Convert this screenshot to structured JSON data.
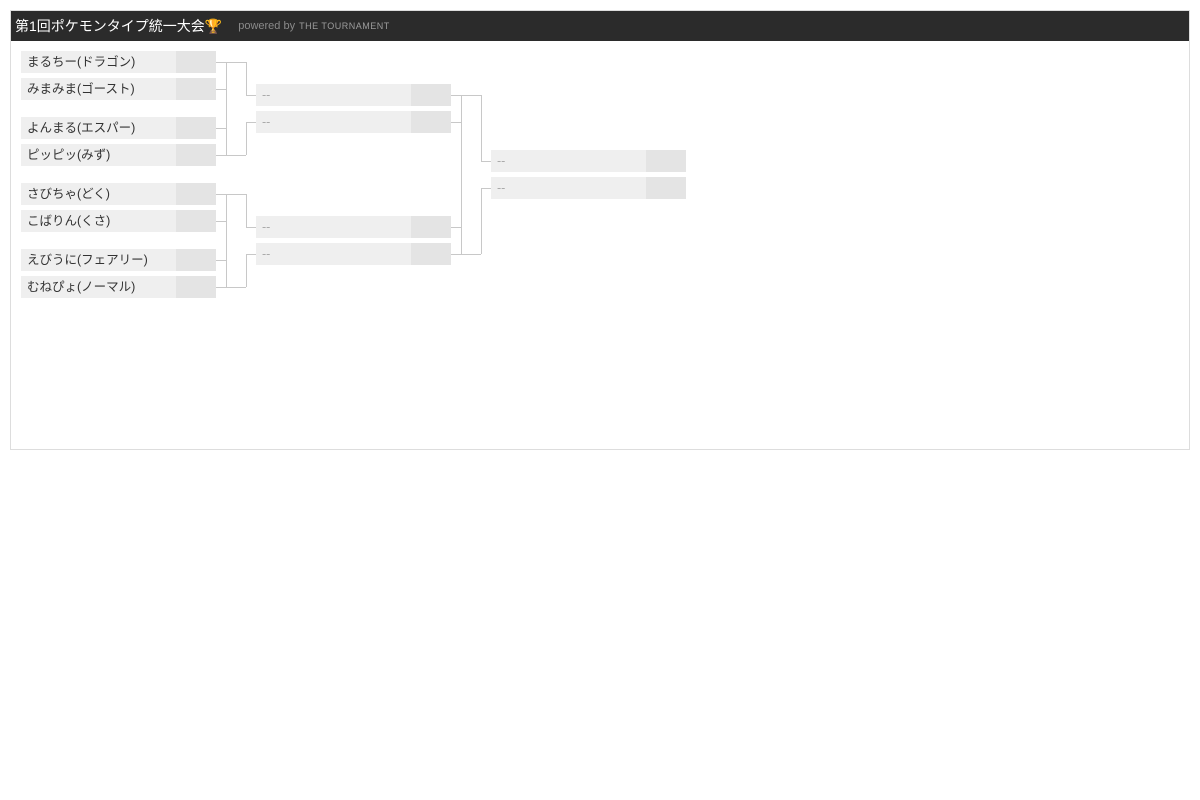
{
  "header": {
    "title": "第1回ポケモンタイプ統一大会🏆",
    "powered_by": "powered by",
    "brand": "THE TOURNAMENT"
  },
  "placeholder": "--",
  "round1": [
    {
      "name": "まるちー(ドラゴン)"
    },
    {
      "name": "みまみま(ゴースト)"
    },
    {
      "name": "よんまる(エスパー)"
    },
    {
      "name": "ピッピッ(みず)"
    },
    {
      "name": "さびちゃ(どく)"
    },
    {
      "name": "こばりん(くさ)"
    },
    {
      "name": "えびうに(フェアリー)"
    },
    {
      "name": "むねぴょ(ノーマル)"
    }
  ]
}
